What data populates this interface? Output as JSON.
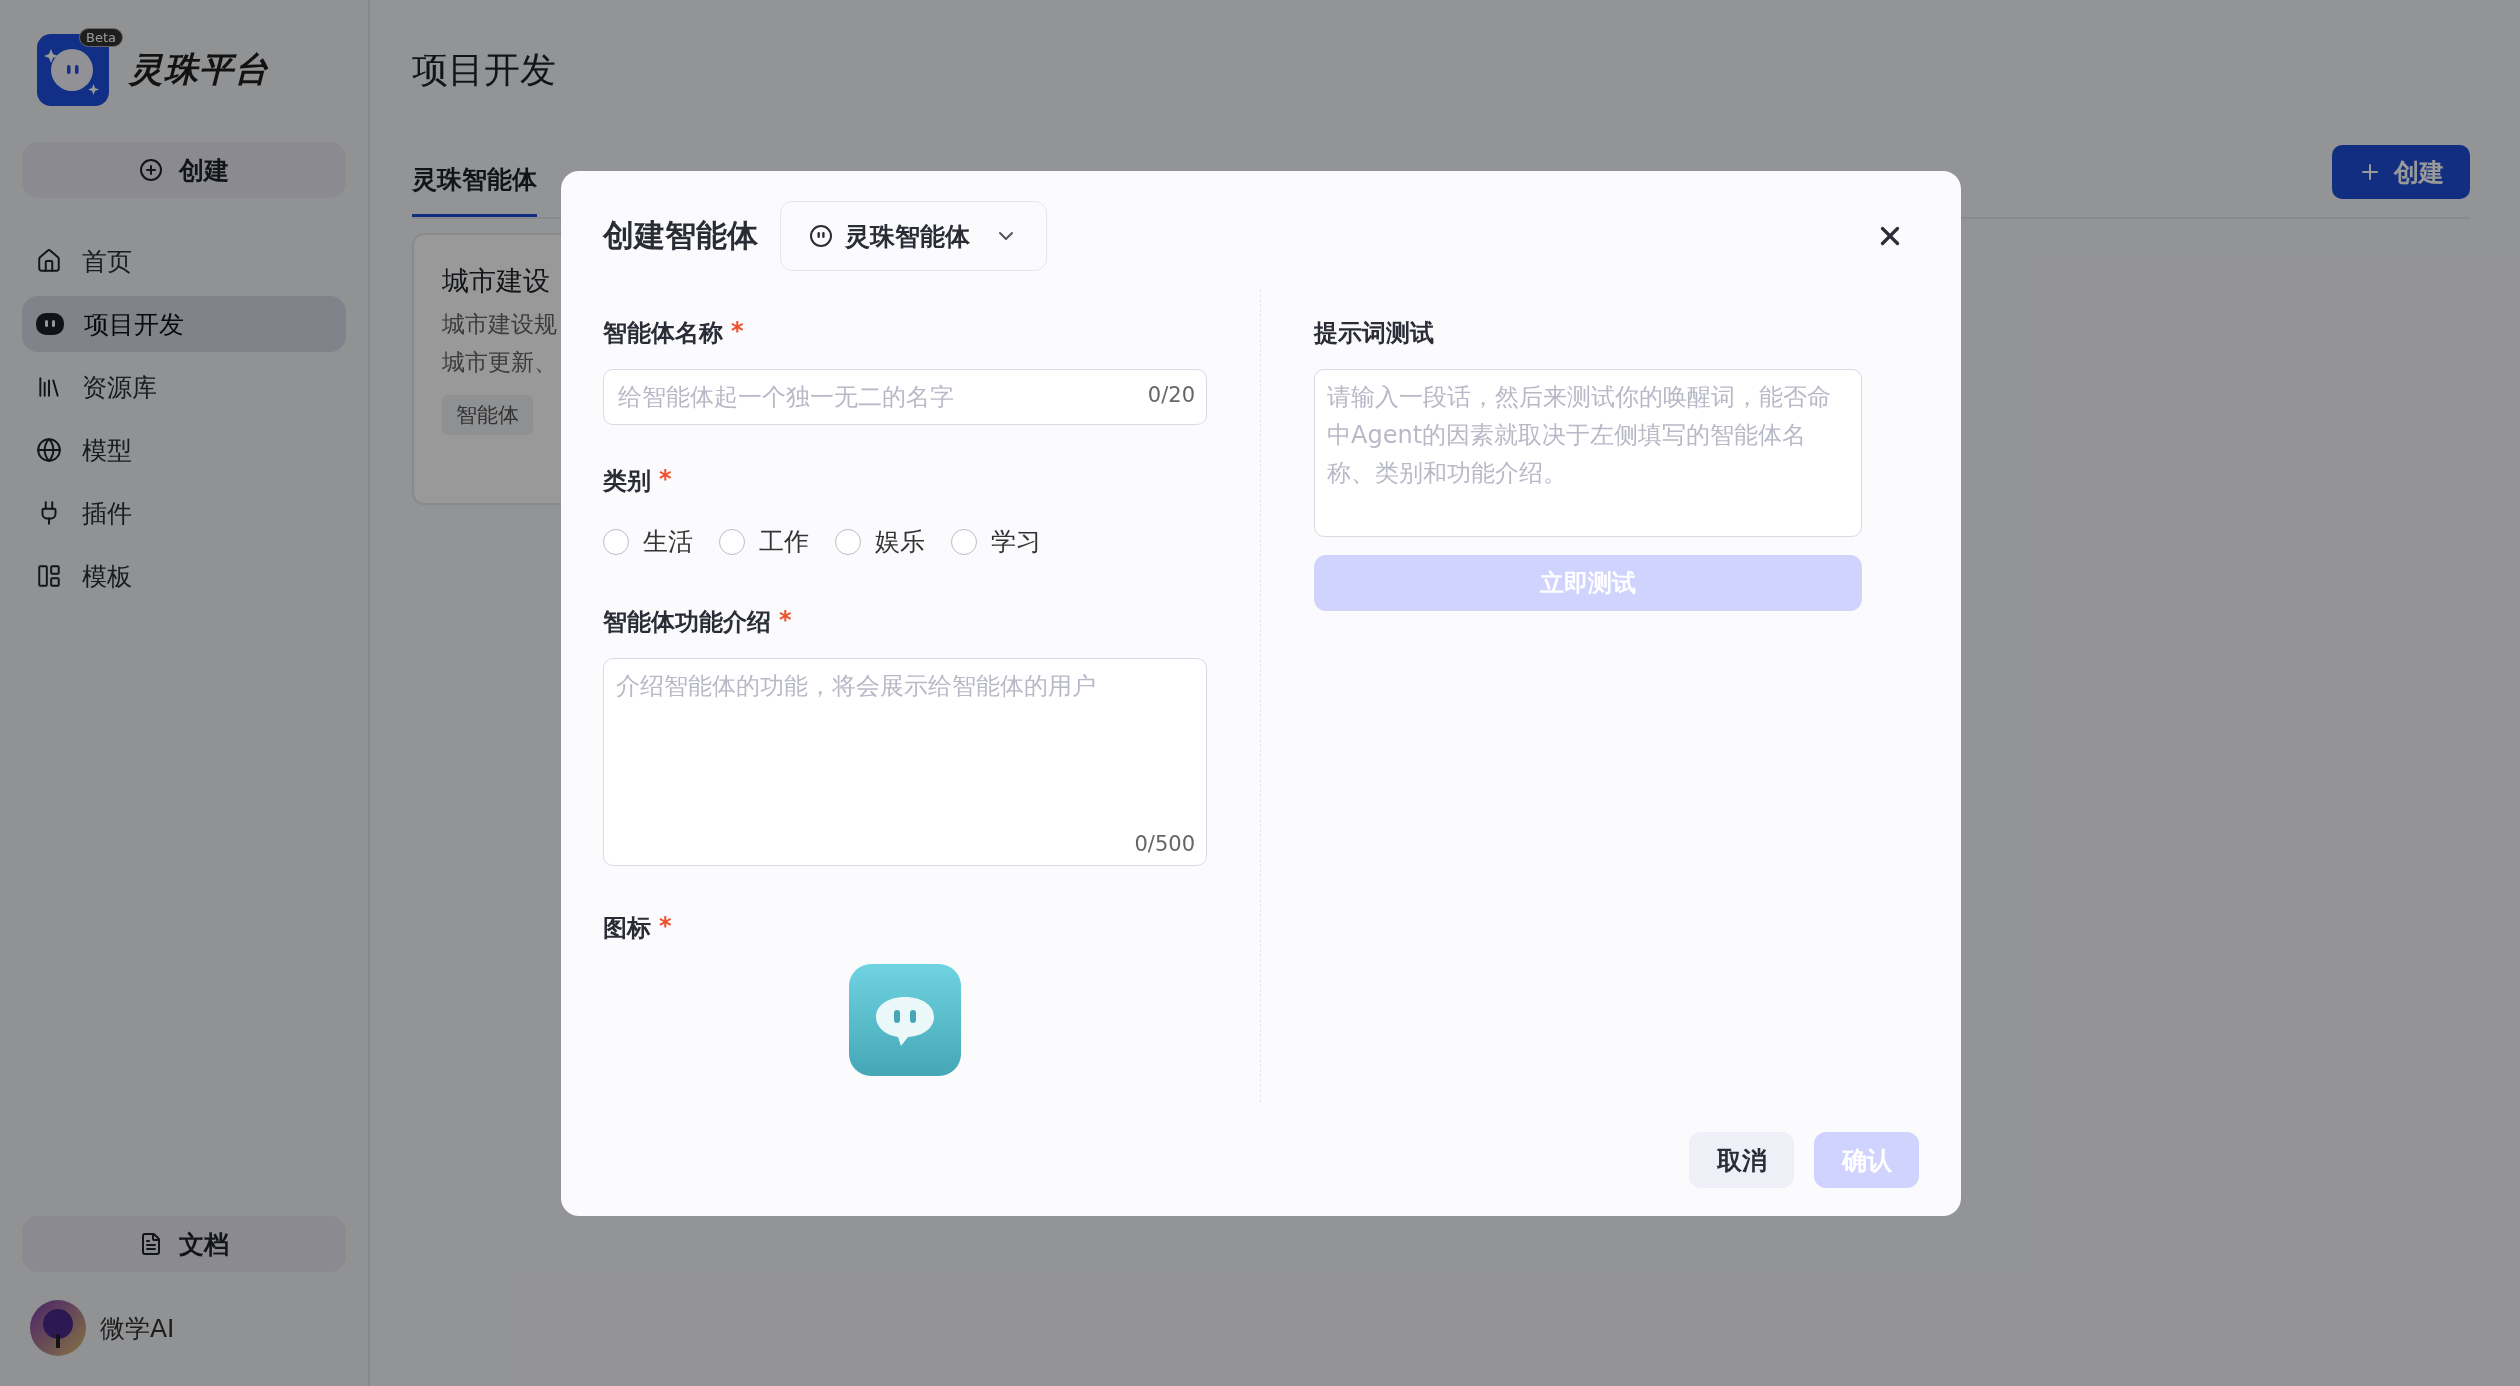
{
  "sidebar": {
    "logo_text": "灵珠平台",
    "badge": "Beta",
    "create_button": "创建",
    "nav": [
      {
        "kind": "home",
        "label": "首页",
        "selected": false
      },
      {
        "kind": "project",
        "label": "项目开发",
        "selected": true
      },
      {
        "kind": "library",
        "label": "资源库",
        "selected": false
      },
      {
        "kind": "model",
        "label": "模型",
        "selected": false
      },
      {
        "kind": "plugin",
        "label": "插件",
        "selected": false
      },
      {
        "kind": "template",
        "label": "模板",
        "selected": false
      }
    ],
    "docs_button": "文档",
    "user": {
      "name": "微学AI"
    }
  },
  "page": {
    "title": "项目开发",
    "tabs": [
      {
        "label": "灵珠智能体",
        "selected": true
      }
    ],
    "create_button": "创建",
    "cards": [
      {
        "title": "城市建设",
        "description": [
          "城市建设规",
          "城市更新、"
        ],
        "tag": "智能体"
      }
    ]
  },
  "dialog": {
    "title": "创建智能体",
    "type_select": "灵珠智能体",
    "name_field": {
      "label": "智能体名称",
      "required_mark": "*",
      "placeholder": "给智能体起一个独一无二的名字",
      "counter": "0/20"
    },
    "category": {
      "label": "类别",
      "required_mark": "*",
      "options": [
        {
          "label": "生活",
          "selected": false
        },
        {
          "label": "工作",
          "selected": false
        },
        {
          "label": "娱乐",
          "selected": false
        },
        {
          "label": "学习",
          "selected": false
        }
      ]
    },
    "intro_field": {
      "label": "智能体功能介绍",
      "required_mark": "*",
      "placeholder": "介绍智能体的功能，将会展示给智能体的用户",
      "counter": "0/500"
    },
    "icon_field": {
      "label": "图标",
      "required_mark": "*"
    },
    "prompt_test": {
      "label": "提示词测试",
      "placeholder": "请输入一段话，然后来测试你的唤醒词，能否命中Agent的因素就取决于左侧填写的智能体名称、类别和功能介绍。",
      "button": {
        "label": "立即测试",
        "disabled": true
      }
    },
    "footer": {
      "cancel": "取消",
      "confirm": {
        "label": "确认",
        "disabled": true
      }
    }
  }
}
